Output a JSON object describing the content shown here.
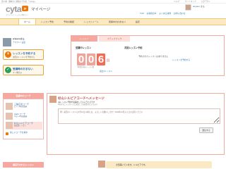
{
  "top_strip": {
    "left_text": "習い事・趣味から資格まで対応 『cyta.jp』",
    "right_links": [
      "ヘルプ",
      "サイトマップ",
      "ログアウト"
    ]
  },
  "brand": {
    "logo_word": "cyta",
    "logo_badge": "jp",
    "section": "マイページ",
    "tagline": "プライベートレッスン予約サイト",
    "accent_color": "#e8780a"
  },
  "user": {
    "name": "ariyaou",
    "suffix": "さん"
  },
  "header_links": [
    "TOP",
    "お客様の声",
    "よくある質問",
    "お問い合わせ"
  ],
  "nav": {
    "items": [
      {
        "label": "ホーム",
        "active": true
      },
      {
        "label": "レッスン予約",
        "active": false
      },
      {
        "label": "予約の確認",
        "active": false
      },
      {
        "label": "レッスンノート",
        "active": false
      },
      {
        "label": "受講中のおまない",
        "active": false
      },
      {
        "label": "設定",
        "active": false
      }
    ]
  },
  "profile": {
    "name": "ariyaou",
    "suffix": "さん",
    "account_link": "アカウント設定"
  },
  "sidebar_buttons": [
    {
      "icon": "plus-icon",
      "line1": "レッスンを予約する",
      "line2": "次回のレッスンを予約する"
    },
    {
      "icon": "check-icon",
      "line1": "受講時のおまない",
      "line2": "マイ教室.jp"
    }
  ],
  "coach_panel": {
    "title": "受講中のコーチ",
    "coaches": [
      {
        "name": "三輪広見コーチ",
        "subject": "ピアノ&発音講座",
        "selected": false
      },
      {
        "name": "KaiS.コーチ",
        "subject": "ギター&作曲講座",
        "selected": false
      },
      {
        "name": "杉山シルビアコーチ",
        "subject": "英会話レッスン",
        "selected": true
      }
    ],
    "add_link": "新しいコーチを探す"
  },
  "recent_title": "最近行われたレッスン",
  "tabs": [
    "レッスン",
    "ステップブック"
  ],
  "plan": {
    "title": "受講中レッスン",
    "digits": [
      "0",
      "0",
      "6"
    ],
    "unit": "回",
    "note": "予約受付前のレッスン数",
    "more_link": "過去のレッスン"
  },
  "schedule": {
    "title": "次回レッスン予約",
    "empty_text": "予約されたレッスンはありません",
    "link": "レッスンを予約する"
  },
  "message": {
    "title": "杉山シルビアコーチへメッセージ",
    "subtitle": "Ukレッスン予約や受講をしてもらうたびです",
    "subtitle2": "5時までにメッセージに返信してお返事がもらえます",
    "placeholder": "例）来回のレッスンは7月12日(1)時にお。よろしくお願いします！2014年12月より日の日程ください",
    "send_label": "送信する",
    "bubble_text": "全部届いています。シルビアです。"
  }
}
